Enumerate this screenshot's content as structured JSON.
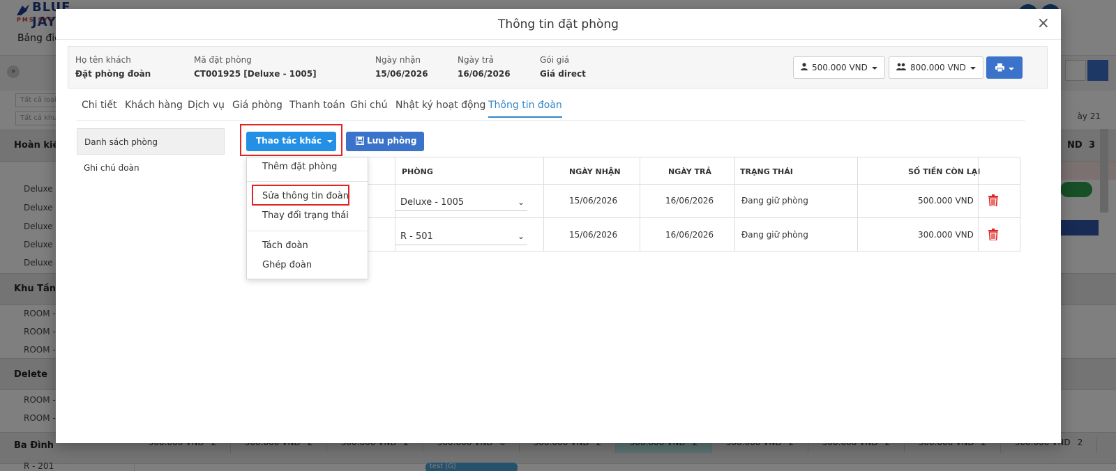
{
  "background": {
    "logo_text": "BLUE JAY",
    "logo_sub": "PMS SYS",
    "nav_item": "Bảng điề",
    "filters": [
      "Tất cả loại",
      "Tất cả khu"
    ],
    "date_label": "ày 21",
    "groups": [
      {
        "label": "Hoàn kiế",
        "rows": [
          "Deluxe -",
          "Deluxe -",
          "Deluxe -",
          "Deluxe -",
          "Deluxe -"
        ]
      },
      {
        "label": "Khu Tầng",
        "rows": [
          "ROOM -",
          "ROOM -",
          "ROOM -"
        ]
      },
      {
        "label": "Delete",
        "rows": [
          "ROOM -",
          "ROOM -"
        ]
      },
      {
        "label": "Ba Đình",
        "rows": [
          "R - 201"
        ]
      }
    ],
    "group_right_values": [
      "ND",
      "3"
    ],
    "price_cells": [
      {
        "price": "500.000 VND",
        "count": "2"
      },
      {
        "price": "500.000 VND",
        "count": "2"
      },
      {
        "price": "500.000 VND",
        "count": "2"
      },
      {
        "price": "500.000 VND",
        "count": "0"
      },
      {
        "price": "500.000 VND",
        "count": "2"
      },
      {
        "price": "500.000 VND",
        "count": "2"
      },
      {
        "price": "500.000 VND",
        "count": "2"
      },
      {
        "price": "500.000 VND",
        "count": "2"
      },
      {
        "price": "500.000 VND",
        "count": "2"
      },
      {
        "price": "500.000 VND",
        "count": "2"
      }
    ],
    "tag": "test (G)"
  },
  "modal": {
    "title": "Thông tin đặt phòng",
    "close": "×",
    "info": {
      "guest_label": "Họ tên khách",
      "guest_value": "Đặt phòng đoàn",
      "code_label": "Mã đặt phòng",
      "code_value": "CT001925 [Deluxe - 1005]",
      "checkin_label": "Ngày nhận",
      "checkin_value": "15/06/2026",
      "checkout_label": "Ngày trả",
      "checkout_value": "16/06/2026",
      "rate_label": "Gói giá",
      "rate_value": "Giá direct"
    },
    "amount_single": "500.000 VND",
    "amount_group": "800.000 VND",
    "tabs": [
      "Chi tiết",
      "Khách hàng",
      "Dịch vụ",
      "Giá phòng",
      "Thanh toán",
      "Ghi chú",
      "Nhật ký hoạt động",
      "Thông tin đoàn"
    ],
    "active_tab_index": 7,
    "side_menu": [
      "Danh sách phòng",
      "Ghi chú đoàn"
    ],
    "action_button": "Thao tác khác",
    "save_button": "Lưu phòng",
    "dropdown_items": [
      "Thêm đặt phòng",
      "Sửa thông tin đoàn",
      "Thay đổi trạng thái",
      "Tách đoàn",
      "Ghép đoàn"
    ],
    "table": {
      "headers": [
        "PHÒNG",
        "NGÀY NHẬN",
        "NGÀY TRẢ",
        "TRẠNG THÁI",
        "SỐ TIỀN CÒN LẠI"
      ],
      "rows": [
        {
          "room": "Deluxe - 1005",
          "checkin": "15/06/2026",
          "checkout": "16/06/2026",
          "status": "Đang giữ phòng",
          "remaining": "500.000 VND"
        },
        {
          "room": "R - 501",
          "checkin": "15/06/2026",
          "checkout": "16/06/2026",
          "status": "Đang giữ phòng",
          "remaining": "300.000 VND"
        }
      ]
    }
  },
  "colors": {
    "primary": "#2390e6",
    "save": "#3a73c9",
    "tab_active": "#3486c6",
    "highlight": "#e02424",
    "trash": "#e02424"
  }
}
